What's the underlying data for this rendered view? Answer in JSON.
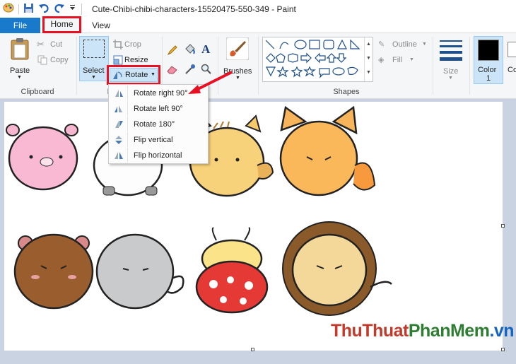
{
  "window": {
    "title": "Cute-Chibi-chibi-characters-15520475-550-349 - Paint"
  },
  "tabs": {
    "file": "File",
    "home": "Home",
    "view": "View"
  },
  "clipboard": {
    "paste": "Paste",
    "cut": "Cut",
    "copy": "Copy",
    "group": "Clipboard"
  },
  "image": {
    "select": "Select",
    "crop": "Crop",
    "resize": "Resize",
    "rotate": "Rotate",
    "group": "I"
  },
  "brushes": {
    "label": "Brushes"
  },
  "shapes": {
    "outline": "Outline",
    "fill": "Fill",
    "group": "Shapes"
  },
  "size": {
    "label": "Size"
  },
  "color": {
    "color1": "Color",
    "color1_num": "1",
    "color2_partial": "Co",
    "color1_hex": "#000000"
  },
  "rotate_menu": [
    {
      "label": "Rotate right 90°",
      "icon": "rotate-right-icon"
    },
    {
      "label": "Rotate left 90°",
      "icon": "rotate-left-icon"
    },
    {
      "label": "Rotate 180°",
      "icon": "rotate-180-icon"
    },
    {
      "label": "Flip vertical",
      "icon": "flip-vertical-icon"
    },
    {
      "label": "Flip horizontal",
      "icon": "flip-horizontal-icon"
    }
  ],
  "watermark": {
    "part1": "ThuThuat",
    "part2": "PhanMem",
    "part3": ".vn"
  },
  "colors": {
    "accent_red": "#e81123",
    "file_tab": "#1979ca",
    "ribbon_bg": "#f5f6f7",
    "workspace": "#c9d3e2"
  }
}
